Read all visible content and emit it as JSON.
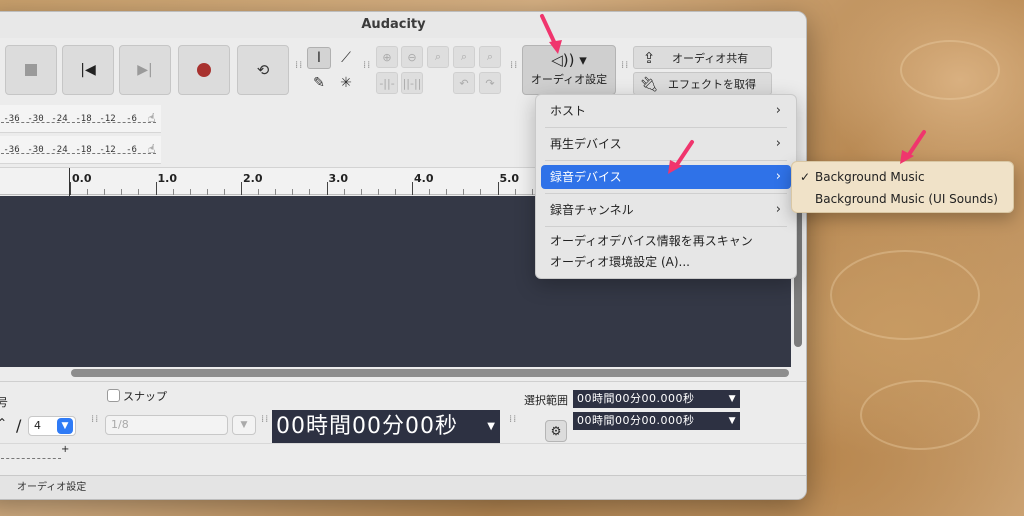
{
  "app": {
    "title": "Audacity"
  },
  "toolbar": {
    "transport_icons": [
      "stop-icon",
      "skip-to-start-icon",
      "skip-to-end-icon",
      "record-icon",
      "loop-icon"
    ],
    "audio_setup_label": "オーディオ設定",
    "share_audio_label": "オーディオ共有",
    "get_effects_label": "エフェクトを取得"
  },
  "meters": {
    "ticks": [
      "-36",
      "-30",
      "-24",
      "-18",
      "-12",
      "-6"
    ]
  },
  "ruler": {
    "labels": [
      "0.0",
      "1.0",
      "2.0",
      "3.0",
      "4.0",
      "5.0"
    ]
  },
  "menu": {
    "items": [
      {
        "label": "ホスト",
        "submenu": true
      },
      {
        "label": "再生デバイス",
        "submenu": true
      },
      {
        "label": "録音デバイス",
        "submenu": true,
        "highlighted": true
      },
      {
        "label": "録音チャンネル",
        "submenu": true
      },
      {
        "label": "オーディオデバイス情報を再スキャン",
        "submenu": false
      },
      {
        "label": "オーディオ環境設定 (A)...",
        "submenu": false
      }
    ]
  },
  "submenu": {
    "items": [
      {
        "label": "Background Music",
        "checked": true
      },
      {
        "label": "Background Music (UI Sounds)",
        "checked": false
      }
    ],
    "check_mark": "✓"
  },
  "bottom": {
    "snap_label": "スナップ",
    "snap_value": "1/8",
    "time_sig_slash": "/",
    "time_sig_denominator": "4",
    "partial_label": "号",
    "time_display": "00時間00分00秒",
    "selection_label": "選択範囲",
    "selection_start": "00時間00分00.000秒",
    "selection_end": "00時間00分00.000秒"
  },
  "status": {
    "text": "オーディオ設定"
  },
  "colors": {
    "accent": "#2f72e8",
    "track_bg": "#343846",
    "record_red": "#a8322f",
    "pointer_pink": "#f0356d"
  }
}
